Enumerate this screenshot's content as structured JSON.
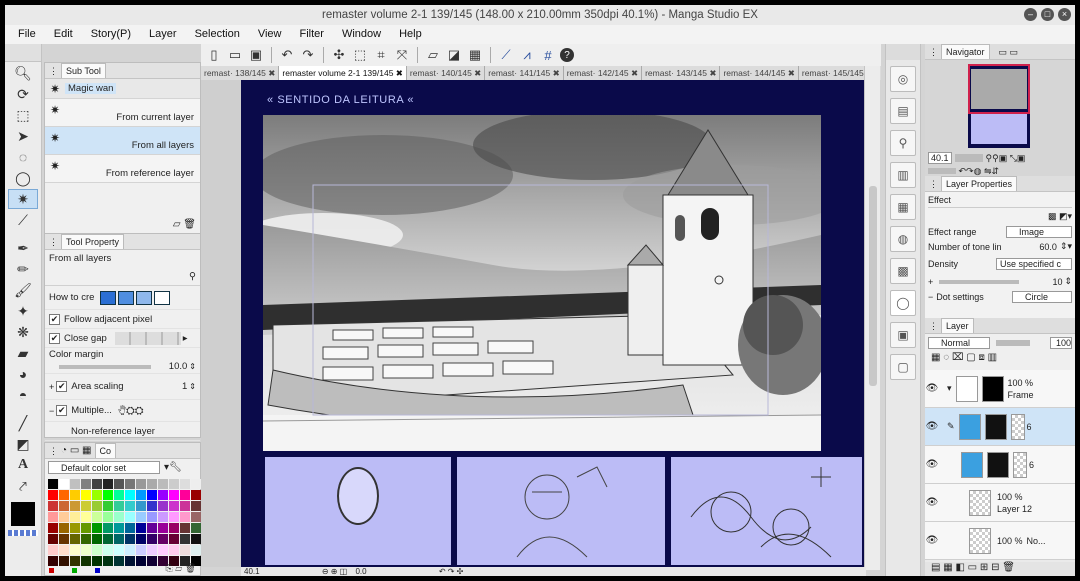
{
  "window": {
    "title": "remaster volume 2-1 139/145 (148.00 x 210.00mm 350dpi 40.1%) - Manga Studio EX"
  },
  "menu": [
    "File",
    "Edit",
    "Story(P)",
    "Layer",
    "Selection",
    "View",
    "Filter",
    "Window",
    "Help"
  ],
  "tabs": [
    "remast· 138/145",
    "remaster volume 2-1 139/145",
    "remast· 140/145",
    "remast· 141/145",
    "remast· 142/145",
    "remast· 143/145",
    "remast· 144/145",
    "remast· 145/145"
  ],
  "subtool": {
    "header": "Sub Tool",
    "items": [
      {
        "label": "Magic wan",
        "sub": ""
      },
      {
        "label": "From current layer"
      },
      {
        "label": "From all layers"
      },
      {
        "label": "From reference layer"
      }
    ]
  },
  "toolprop": {
    "header": "Tool Property",
    "title": "From all layers",
    "how_to": "How to cre",
    "follow": "Follow adjacent pixel",
    "close_gap": "Close gap",
    "color_margin": "Color margin",
    "color_margin_val": "10.0",
    "area_scaling": "Area scaling",
    "area_scaling_val": "1",
    "multiple": "Multiple...",
    "non_ref": "Non-reference layer"
  },
  "color": {
    "tab": "Co",
    "set": "Default color set"
  },
  "canvas": {
    "reading": "« SENTIDO DA LEITURA «",
    "zoom": "40.1",
    "rotate": "0.0"
  },
  "navigator": {
    "header": "Navigator",
    "zoom": "40.1"
  },
  "layerprop": {
    "header": "Layer Properties",
    "effect": "Effect",
    "effect_range": "Effect range",
    "effect_range_val": "Image",
    "tone_lines": "Number of tone lin",
    "tone_lines_val": "60.0",
    "density": "Density",
    "density_val": "Use specified c",
    "dot_settings": "Dot settings",
    "dot_settings_val": "Circle",
    "small_val": "10"
  },
  "layers": {
    "header": "Layer",
    "blend": "Normal",
    "opacity": "100",
    "rows": [
      {
        "pct": "100 %",
        "name": "Frame"
      },
      {
        "pct": "",
        "name": "6"
      },
      {
        "pct": "",
        "name": "6"
      },
      {
        "pct": "100 %",
        "name": "No..."
      },
      {
        "pct": "",
        "name": "Layer 12"
      },
      {
        "pct": "100 %",
        "name": "No..."
      }
    ]
  }
}
